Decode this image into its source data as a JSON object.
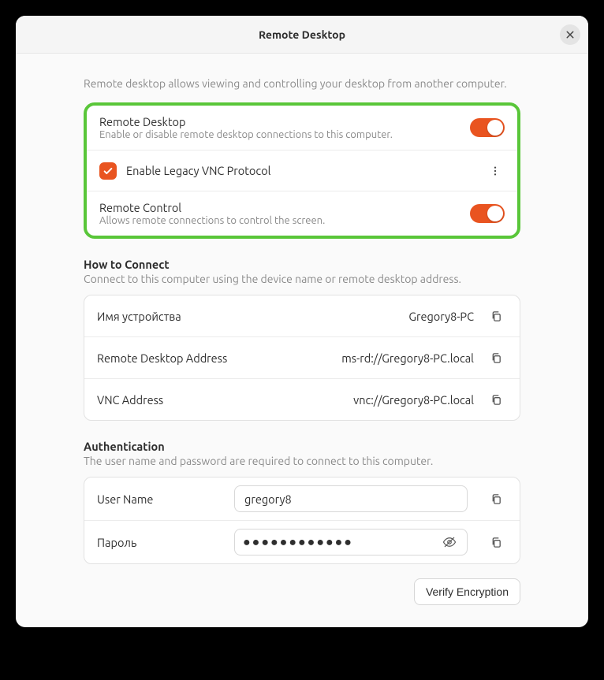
{
  "title": "Remote Desktop",
  "intro": "Remote desktop allows viewing and controlling your desktop from another computer.",
  "toggles": {
    "remote_desktop": {
      "label": "Remote Desktop",
      "sub": "Enable or disable remote desktop connections to this computer.",
      "on": true
    },
    "legacy_vnc": {
      "label": "Enable Legacy VNC Protocol",
      "checked": true
    },
    "remote_control": {
      "label": "Remote Control",
      "sub": "Allows remote connections to control the screen.",
      "on": true
    }
  },
  "connect": {
    "title": "How to Connect",
    "sub": "Connect to this computer using the device name or remote desktop address.",
    "rows": [
      {
        "label": "Имя устройства",
        "value": "Gregory8-PC"
      },
      {
        "label": "Remote Desktop Address",
        "value": "ms-rd://Gregory8-PC.local"
      },
      {
        "label": "VNC Address",
        "value": "vnc://Gregory8-PC.local"
      }
    ]
  },
  "auth": {
    "title": "Authentication",
    "sub": "The user name and password are required to connect to this computer.",
    "username_label": "User Name",
    "username_value": "gregory8",
    "password_label": "Пароль",
    "password_masked": "●●●●●●●●●●●●"
  },
  "verify_button": "Verify Encryption"
}
